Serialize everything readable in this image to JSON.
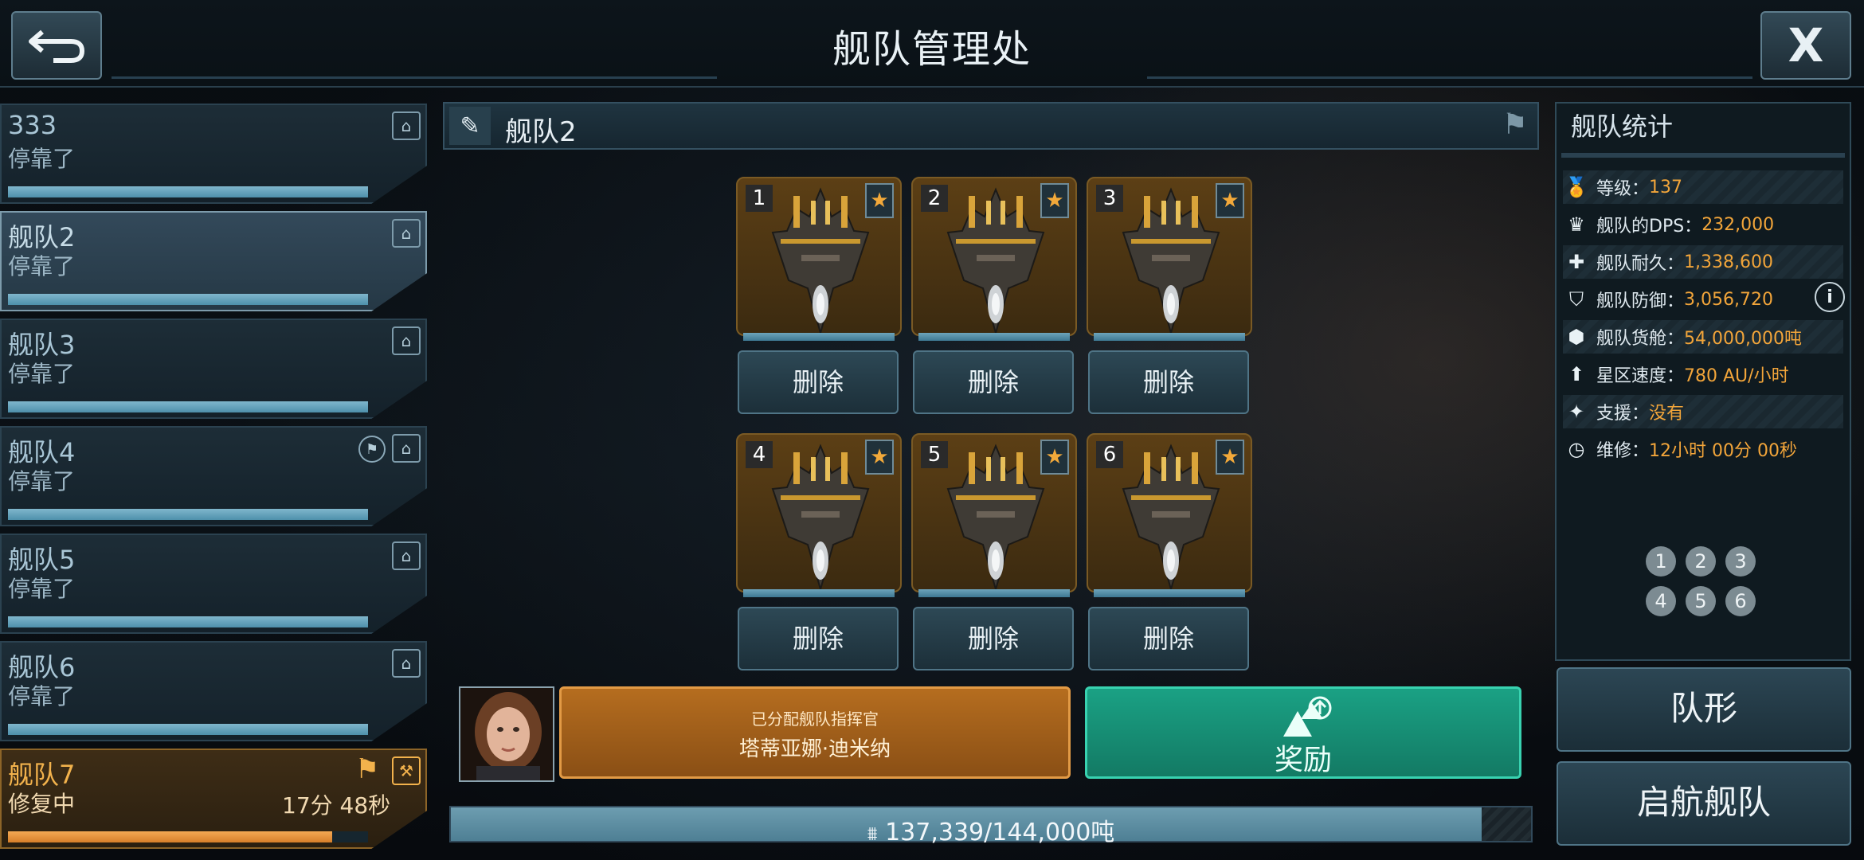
{
  "header": {
    "title": "舰队管理处",
    "back_icon": "back-arrow-icon",
    "close_label": "X"
  },
  "fleets": [
    {
      "name": "333",
      "status": "停靠了",
      "time": "",
      "progress": 1.0,
      "selected": false,
      "repairing": false,
      "flag": false
    },
    {
      "name": "舰队2",
      "status": "停靠了",
      "time": "",
      "progress": 1.0,
      "selected": true,
      "repairing": false,
      "flag": false
    },
    {
      "name": "舰队3",
      "status": "停靠了",
      "time": "",
      "progress": 1.0,
      "selected": false,
      "repairing": false,
      "flag": false
    },
    {
      "name": "舰队4",
      "status": "停靠了",
      "time": "",
      "progress": 1.0,
      "selected": false,
      "repairing": false,
      "flag": true
    },
    {
      "name": "舰队5",
      "status": "停靠了",
      "time": "",
      "progress": 1.0,
      "selected": false,
      "repairing": false,
      "flag": false
    },
    {
      "name": "舰队6",
      "status": "停靠了",
      "time": "",
      "progress": 1.0,
      "selected": false,
      "repairing": false,
      "flag": false
    },
    {
      "name": "舰队7",
      "status": "修复中",
      "time": "17分 48秒",
      "progress": 0.9,
      "selected": false,
      "repairing": true,
      "flag": true
    }
  ],
  "fleet_panel": {
    "title": "舰队2"
  },
  "ships": [
    {
      "slot": "1",
      "delete_label": "删除"
    },
    {
      "slot": "2",
      "delete_label": "删除"
    },
    {
      "slot": "3",
      "delete_label": "删除"
    },
    {
      "slot": "4",
      "delete_label": "删除"
    },
    {
      "slot": "5",
      "delete_label": "删除"
    },
    {
      "slot": "6",
      "delete_label": "删除"
    }
  ],
  "commander": {
    "label": "已分配舰队指挥官",
    "name": "塔蒂亚娜·迪米纳"
  },
  "reward": {
    "label": "奖励"
  },
  "cargo": {
    "text": "137,339/144,000吨",
    "fill": 0.954
  },
  "stats": {
    "title": "舰队统计",
    "rows": [
      {
        "label": "等级：",
        "value": "137",
        "icon": "medal-icon"
      },
      {
        "label": "舰队的DPS：",
        "value": "232,000",
        "icon": "crown-icon"
      },
      {
        "label": "舰队耐久：",
        "value": "1,338,600",
        "icon": "plus-icon"
      },
      {
        "label": "舰队防御：",
        "value": "3,056,720",
        "icon": "shield-icon"
      },
      {
        "label": "舰队货舱：",
        "value": "54,000,000吨",
        "icon": "cargo-box-icon"
      },
      {
        "label": "星区速度：",
        "value": "780 AU/小时",
        "icon": "up-arrow-icon"
      },
      {
        "label": "支援：",
        "value": "没有",
        "icon": "support-star-icon"
      },
      {
        "label": "维修：",
        "value": "12小时 00分 00秒",
        "icon": "clock-icon"
      }
    ],
    "formation_dots": [
      "1",
      "2",
      "3",
      "4",
      "5",
      "6"
    ]
  },
  "buttons": {
    "formation": "队形",
    "launch": "启航舰队"
  },
  "colors": {
    "accent_orange": "#f2a53a",
    "reward_green": "#1aa184",
    "panel_blue": "#2c4654"
  }
}
